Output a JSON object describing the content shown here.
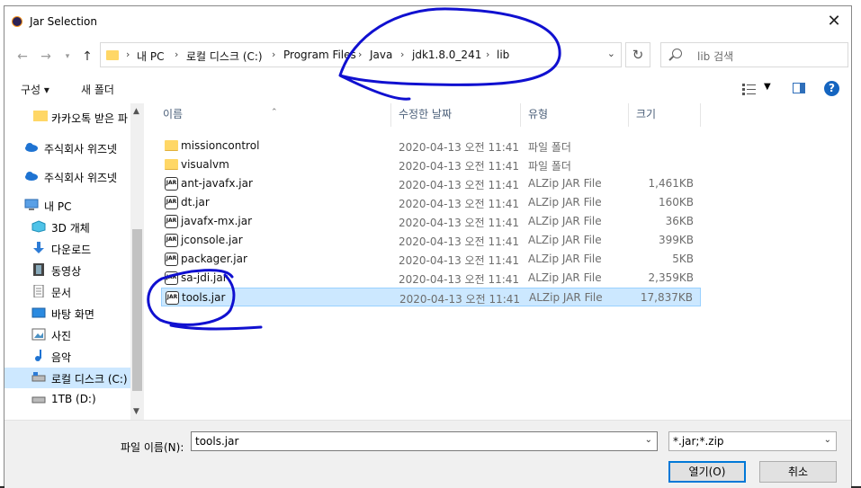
{
  "dialog": {
    "title": "Jar Selection",
    "close": "✕"
  },
  "address": {
    "crumbs": [
      "내 PC",
      "로컬 디스크 (C:)",
      "Program Files",
      "Java",
      "jdk1.8.0_241",
      "lib"
    ]
  },
  "search": {
    "placeholder": "lib 검색"
  },
  "toolbar": {
    "organize": "구성 ▾",
    "new_folder": "새 폴더"
  },
  "sidebar": {
    "items": [
      {
        "label": "카카오톡 받은 파",
        "icon": "folder-icon"
      },
      {
        "label": "주식회사 위즈넷",
        "icon": "cloud-icon"
      },
      {
        "label": "주식회사 위즈넷",
        "icon": "cloud-icon"
      },
      {
        "label": "내 PC",
        "icon": "computer-icon"
      },
      {
        "label": "3D 개체",
        "icon": "cube-icon"
      },
      {
        "label": "다운로드",
        "icon": "download-icon"
      },
      {
        "label": "동영상",
        "icon": "video-icon"
      },
      {
        "label": "문서",
        "icon": "document-icon"
      },
      {
        "label": "바탕 화면",
        "icon": "desktop-icon"
      },
      {
        "label": "사진",
        "icon": "picture-icon"
      },
      {
        "label": "음악",
        "icon": "music-icon"
      },
      {
        "label": "로컬 디스크 (C:)",
        "icon": "drive-icon"
      },
      {
        "label": "1TB (D:)",
        "icon": "drive-icon"
      }
    ]
  },
  "columns": {
    "name": "이름",
    "date": "수정한 날짜",
    "type": "유형",
    "size": "크기"
  },
  "files": [
    {
      "name": "missioncontrol",
      "date": "2020-04-13 오전 11:41",
      "type": "파일 폴더",
      "size": "",
      "kind": "folder"
    },
    {
      "name": "visualvm",
      "date": "2020-04-13 오전 11:41",
      "type": "파일 폴더",
      "size": "",
      "kind": "folder"
    },
    {
      "name": "ant-javafx.jar",
      "date": "2020-04-13 오전 11:41",
      "type": "ALZip JAR File",
      "size": "1,461KB",
      "kind": "jar"
    },
    {
      "name": "dt.jar",
      "date": "2020-04-13 오전 11:41",
      "type": "ALZip JAR File",
      "size": "160KB",
      "kind": "jar"
    },
    {
      "name": "javafx-mx.jar",
      "date": "2020-04-13 오전 11:41",
      "type": "ALZip JAR File",
      "size": "36KB",
      "kind": "jar"
    },
    {
      "name": "jconsole.jar",
      "date": "2020-04-13 오전 11:41",
      "type": "ALZip JAR File",
      "size": "399KB",
      "kind": "jar"
    },
    {
      "name": "packager.jar",
      "date": "2020-04-13 오전 11:41",
      "type": "ALZip JAR File",
      "size": "5KB",
      "kind": "jar"
    },
    {
      "name": "sa-jdi.jar",
      "date": "2020-04-13 오전 11:41",
      "type": "ALZip JAR File",
      "size": "2,359KB",
      "kind": "jar"
    },
    {
      "name": "tools.jar",
      "date": "2020-04-13 오전 11:41",
      "type": "ALZip JAR File",
      "size": "17,837KB",
      "kind": "jar",
      "selected": true
    }
  ],
  "footer": {
    "filename_label": "파일 이름(N):",
    "filename_value": "tools.jar",
    "filetype_value": "*.jar;*.zip",
    "open_label": "열기(O)",
    "cancel_label": "취소"
  },
  "colors": {
    "selection": "#cce8ff",
    "annotation_ink": "#1010d0"
  }
}
